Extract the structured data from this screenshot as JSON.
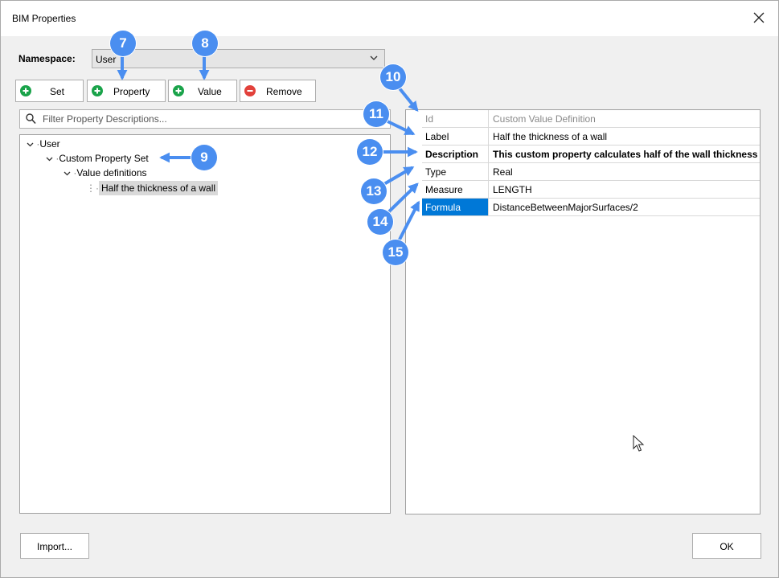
{
  "window": {
    "title": "BIM Properties"
  },
  "namespace": {
    "label": "Namespace:",
    "value": "User"
  },
  "toolbar": {
    "set": "Set",
    "property": "Property",
    "value": "Value",
    "remove": "Remove"
  },
  "filter": {
    "placeholder": "Filter Property Descriptions..."
  },
  "tree": {
    "root": "User",
    "set": "Custom Property Set",
    "group": "Value definitions",
    "item": "Half the thickness of a wall"
  },
  "properties": [
    {
      "key": "Id",
      "value": "Custom Value Definition"
    },
    {
      "key": "Label",
      "value": "Half the thickness of a wall"
    },
    {
      "key": "Description",
      "value": "This custom property calculates half of the wall thickness"
    },
    {
      "key": "Type",
      "value": "Real"
    },
    {
      "key": "Measure",
      "value": "LENGTH"
    },
    {
      "key": "Formula",
      "value": "DistanceBetweenMajorSurfaces/2"
    }
  ],
  "buttons": {
    "import": "Import...",
    "ok": "OK"
  },
  "callouts": [
    "7",
    "8",
    "9",
    "10",
    "11",
    "12",
    "13",
    "14",
    "15"
  ],
  "colors": {
    "callout": "#4a8ef0",
    "add_icon": "#1aa34a",
    "remove_icon": "#e2413b",
    "selection": "#0078d7"
  }
}
